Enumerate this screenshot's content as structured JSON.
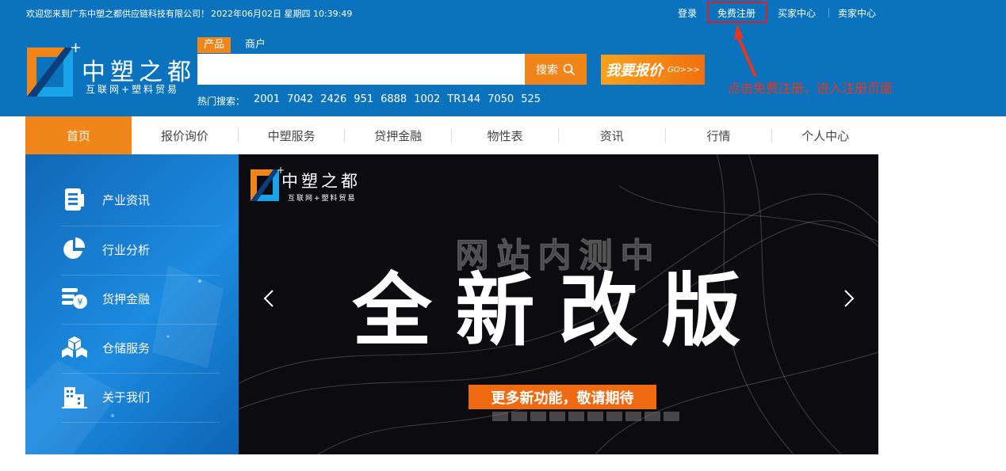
{
  "topbar": {
    "welcome": "欢迎您来到广东中塑之都供应链科技有限公司！",
    "datetime": "2022年06月02日 星期四 10:39:49",
    "links": {
      "login": "登录",
      "register": "免费注册",
      "buyer": "买家中心",
      "seller": "卖家中心"
    }
  },
  "logo": {
    "name": "中塑之都",
    "tagline": "互联网+塑料贸易"
  },
  "search": {
    "tabs": {
      "product": "产品",
      "merchant": "商户"
    },
    "value": "",
    "button": "搜索",
    "quote_main": "我要报价",
    "quote_go": "GO>>>"
  },
  "hot": {
    "label": "热门搜索：",
    "items": [
      "2001",
      "7042",
      "2426",
      "951",
      "6888",
      "1002",
      "TR144",
      "7050",
      "525"
    ]
  },
  "annotation": "点击免费注册，进入注册页面",
  "nav": [
    "首页",
    "报价询价",
    "中塑服务",
    "贷押金融",
    "物性表",
    "资讯",
    "行情",
    "个人中心"
  ],
  "sidebar": [
    {
      "label": "产业资讯",
      "icon": "document-icon"
    },
    {
      "label": "行业分析",
      "icon": "pie-chart-icon"
    },
    {
      "label": "货押金融",
      "icon": "finance-icon"
    },
    {
      "label": "仓储服务",
      "icon": "boxes-icon"
    },
    {
      "label": "关于我们",
      "icon": "building-icon"
    }
  ],
  "banner": {
    "logo_name": "中塑之都",
    "logo_tagline": "互联网+塑料贸易",
    "headline_small": "网站内测中",
    "headline_big": "全新改版",
    "cta": "更多新功能，敬请期待"
  },
  "colors": {
    "header_blue": "#0b73be",
    "accent_orange": "#f08519",
    "annotation_red": "#e8361c"
  }
}
